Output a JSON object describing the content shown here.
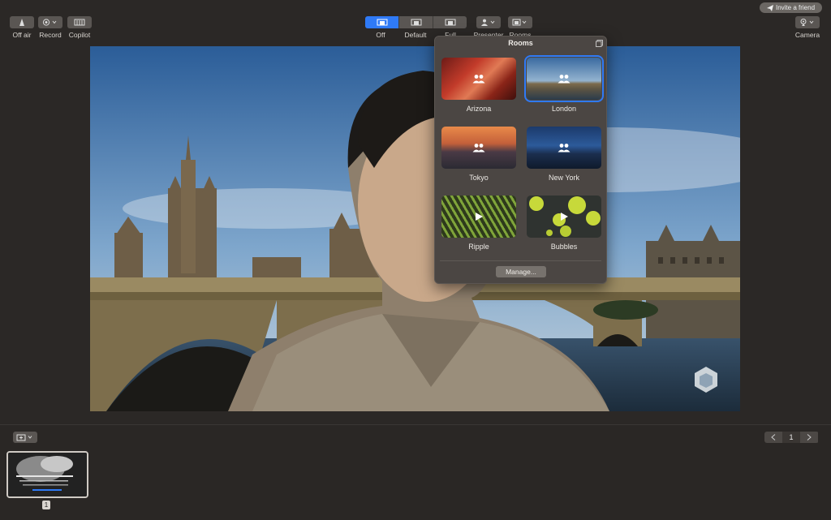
{
  "invite": {
    "label": "Invite a friend",
    "icon": "paper-plane-icon"
  },
  "toolbar": {
    "off_air": "Off air",
    "record": "Record",
    "copilot": "Copilot",
    "layouts": [
      "Off",
      "Default",
      "Full"
    ],
    "layout_selected": "Off",
    "presenter": "Presenter",
    "rooms": "Rooms",
    "camera": "Camera"
  },
  "rooms_popover": {
    "title": "Rooms",
    "items": [
      {
        "label": "Arizona",
        "icon": "people-icon"
      },
      {
        "label": "London",
        "icon": "people-icon"
      },
      {
        "label": "Tokyo",
        "icon": "people-icon"
      },
      {
        "label": "New York",
        "icon": "people-icon"
      },
      {
        "label": "Ripple",
        "icon": "play-icon"
      },
      {
        "label": "Bubbles",
        "icon": "play-icon"
      }
    ],
    "selected": "London",
    "manage_label": "Manage..."
  },
  "bottom": {
    "page": "1",
    "slide_number": "1"
  },
  "colors": {
    "accent": "#2f7af6",
    "background": "#2b2826"
  }
}
